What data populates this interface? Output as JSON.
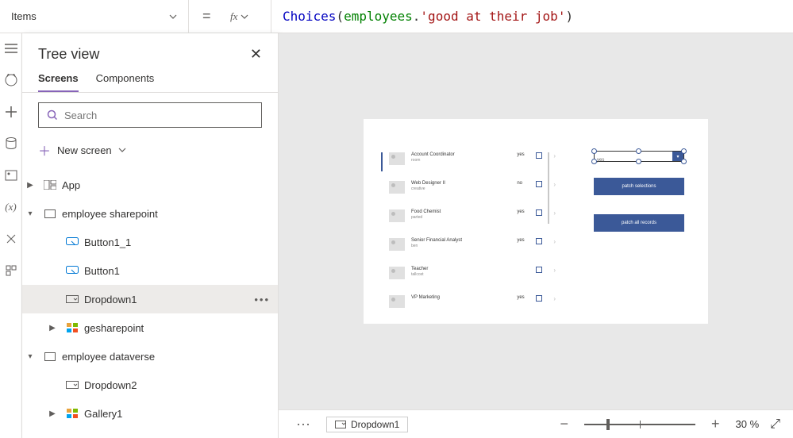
{
  "property_selector": {
    "value": "Items"
  },
  "formula": {
    "function": "Choices",
    "datasource": "employees",
    "field": "'good at their job'"
  },
  "tree_view": {
    "title": "Tree view",
    "tabs": {
      "screens": "Screens",
      "components": "Components"
    },
    "search_placeholder": "Search",
    "new_screen": "New screen",
    "nodes": {
      "app": "App",
      "emp_sp": "employee sharepoint",
      "button1_1": "Button1_1",
      "button1": "Button1",
      "dropdown1": "Dropdown1",
      "gesharepoint": "gesharepoint",
      "emp_dv": "employee dataverse",
      "dropdown2": "Dropdown2",
      "gallery1": "Gallery1"
    }
  },
  "gallery_rows": [
    {
      "title": "Account Coordinator",
      "sub": "room",
      "yn": "yes"
    },
    {
      "title": "Web Designer II",
      "sub": "creative",
      "yn": "no"
    },
    {
      "title": "Food Chemist",
      "sub": "parted",
      "yn": "yes"
    },
    {
      "title": "Senior Financial Analyst",
      "sub": "ben",
      "yn": "yes"
    },
    {
      "title": "Teacher",
      "sub": "tallcost",
      "yn": ""
    },
    {
      "title": "VP Marketing",
      "sub": "",
      "yn": "yes"
    }
  ],
  "canvas": {
    "dropdown_value": "yes",
    "btn_patch_sel": "patch selections",
    "btn_patch_all": "patch all records"
  },
  "status": {
    "selected": "Dropdown1",
    "zoom": "30",
    "zoom_unit": "%"
  }
}
